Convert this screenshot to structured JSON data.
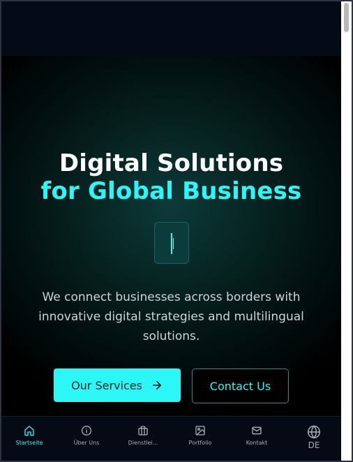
{
  "hero": {
    "title_line1": "Digital Solutions",
    "title_line2": "for Global Business",
    "description": "We connect businesses across borders with innovative digital strategies and multilingual solutions.",
    "primary_button": "Our Services",
    "secondary_button": "Contact Us"
  },
  "nav": {
    "items": [
      {
        "label": "Startseite",
        "icon": "home-icon",
        "active": true
      },
      {
        "label": "Über Uns",
        "icon": "info-icon",
        "active": false
      },
      {
        "label": "Dienstlei...",
        "icon": "briefcase-icon",
        "active": false
      },
      {
        "label": "Portfolio",
        "icon": "image-icon",
        "active": false
      },
      {
        "label": "Kontakt",
        "icon": "mail-icon",
        "active": false
      }
    ],
    "language": "DE"
  },
  "colors": {
    "accent": "#2df6f6",
    "background": "#000000",
    "text_muted": "#a7b0bc"
  }
}
